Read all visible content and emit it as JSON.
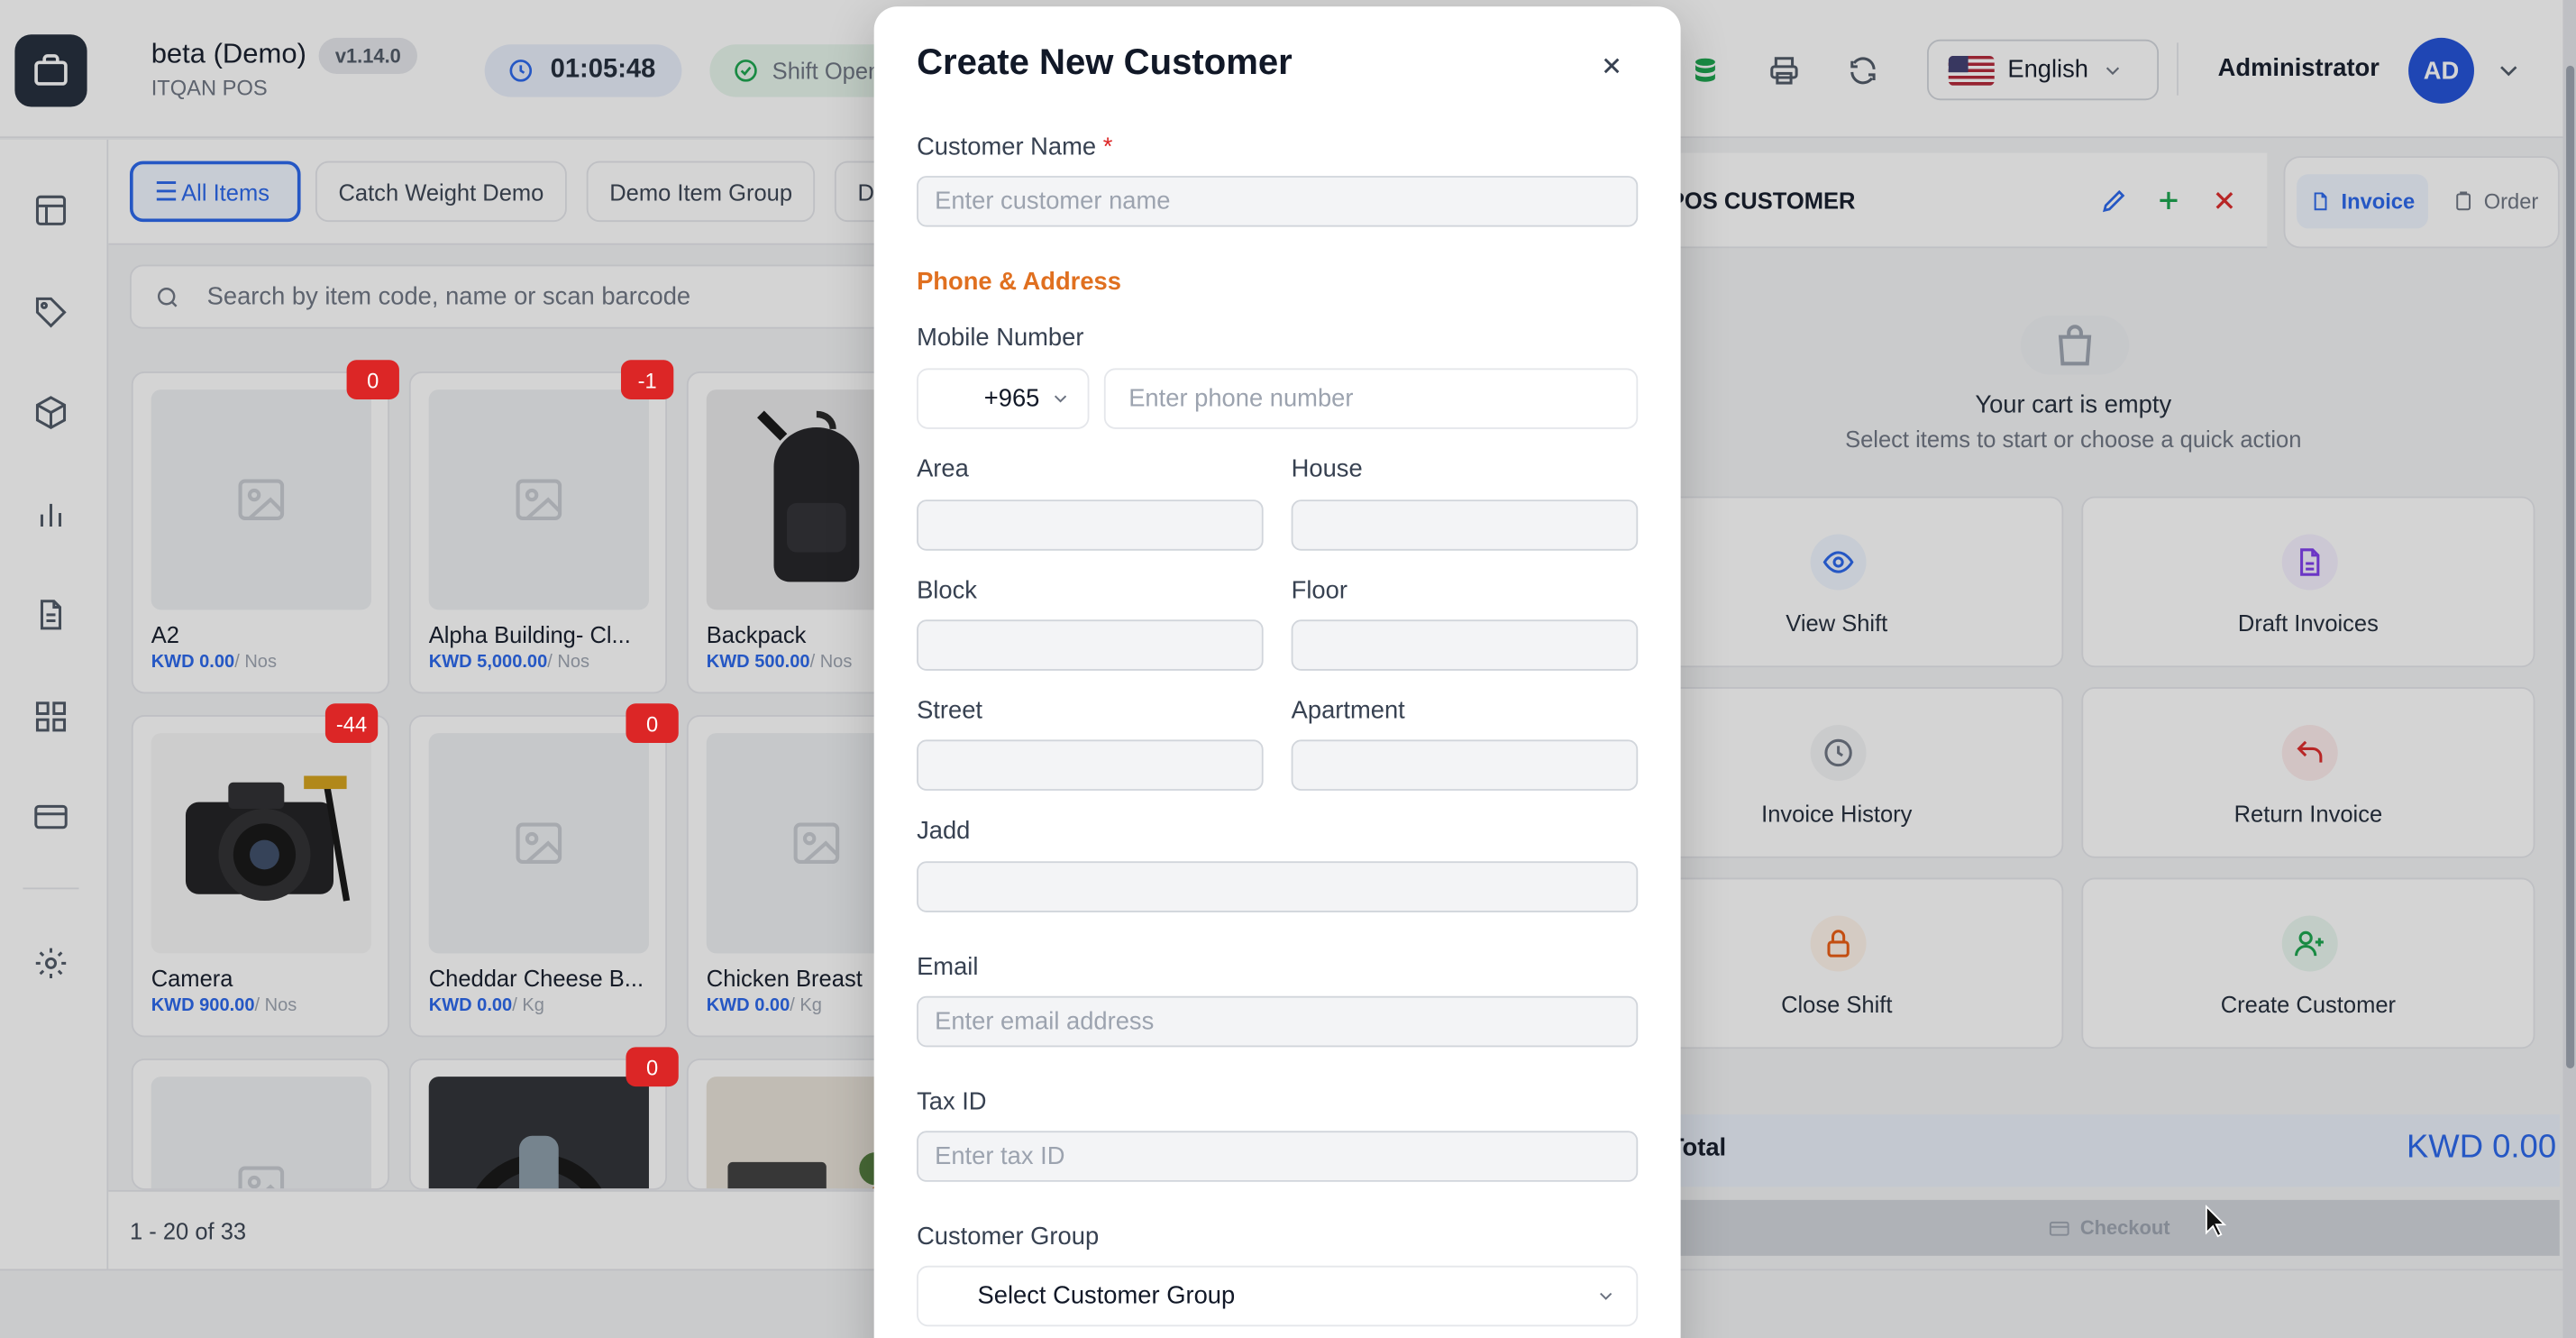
{
  "app": {
    "title": "beta (Demo)",
    "version": "v1.14.0",
    "company": "ITQAN POS"
  },
  "header": {
    "timer": "01:05:48",
    "shift_status": "Shift Open",
    "language": "English",
    "user": "Administrator",
    "avatar_initials": "AD"
  },
  "item_groups": [
    "All Items",
    "Catch Weight Demo",
    "Demo Item Group",
    "D"
  ],
  "search": {
    "placeholder": "Search by item code, name or scan barcode"
  },
  "items": [
    {
      "name": "A2",
      "price": "KWD 0.00",
      "uom": "/ Nos",
      "stock": "0"
    },
    {
      "name": "Alpha Building- Cl...",
      "price": "KWD 5,000.00",
      "uom": "/ Nos",
      "stock": "-1"
    },
    {
      "name": "Backpack",
      "price": "KWD 500.00",
      "uom": "/ Nos",
      "stock": ""
    },
    {
      "name": "Camera",
      "price": "KWD 900.00",
      "uom": "/ Nos",
      "stock": "-44"
    },
    {
      "name": "Cheddar Cheese B...",
      "price": "KWD 0.00",
      "uom": "/ Kg",
      "stock": "0"
    },
    {
      "name": "Chicken Breast",
      "price": "KWD 0.00",
      "uom": "/ Kg",
      "stock": ""
    },
    {
      "name": "",
      "price": "",
      "uom": "",
      "stock": ""
    },
    {
      "name": "",
      "price": "",
      "uom": "",
      "stock": "0"
    },
    {
      "name": "",
      "price": "",
      "uom": "",
      "stock": ""
    }
  ],
  "pagination": {
    "text": "1 - 20 of 33"
  },
  "customer_bar": {
    "name": "POS CUSTOMER"
  },
  "mode": {
    "invoice": "Invoice",
    "order": "Order"
  },
  "cart": {
    "empty_title": "Your cart is empty",
    "empty_subtitle": "Select items to start or choose a quick action"
  },
  "quick_actions": [
    "View Shift",
    "Draft Invoices",
    "Invoice History",
    "Return Invoice",
    "Close Shift",
    "Create Customer"
  ],
  "totals": {
    "label": "Total",
    "value": "KWD 0.00"
  },
  "checkout": {
    "label": "Checkout"
  },
  "modal": {
    "title": "Create New Customer",
    "customer_name_label": "Customer Name",
    "required_mark": "*",
    "customer_name_placeholder": "Enter customer name",
    "section_phone_address": "Phone & Address",
    "mobile_label": "Mobile Number",
    "country_code": "+965",
    "phone_placeholder": "Enter phone number",
    "area_label": "Area",
    "house_label": "House",
    "block_label": "Block",
    "floor_label": "Floor",
    "street_label": "Street",
    "apartment_label": "Apartment",
    "jadd_label": "Jadd",
    "email_label": "Email",
    "email_placeholder": "Enter email address",
    "tax_label": "Tax ID",
    "tax_placeholder": "Enter tax ID",
    "group_label": "Customer Group",
    "group_select": "Select Customer Group"
  },
  "colors": {
    "primary": "#2563eb",
    "danger": "#dc2626",
    "accent_orange": "#e07020"
  }
}
